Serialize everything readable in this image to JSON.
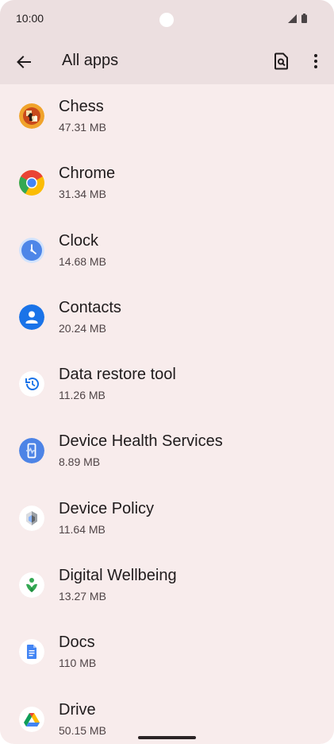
{
  "status_bar": {
    "time": "10:00",
    "icons": [
      "camera-cutout-icon",
      "cellular-signal-icon",
      "battery-icon"
    ]
  },
  "app_bar": {
    "back_icon": "arrow-back-icon",
    "title": "All apps",
    "search_icon": "search-icon",
    "more_icon": "more-vert-icon"
  },
  "apps": [
    {
      "name": "Chess",
      "size": "47.31 MB",
      "icon": "chess-icon"
    },
    {
      "name": "Chrome",
      "size": "31.34 MB",
      "icon": "chrome-icon"
    },
    {
      "name": "Clock",
      "size": "14.68 MB",
      "icon": "clock-icon"
    },
    {
      "name": "Contacts",
      "size": "20.24 MB",
      "icon": "contacts-icon"
    },
    {
      "name": "Data restore tool",
      "size": "11.26 MB",
      "icon": "data-restore-icon"
    },
    {
      "name": "Device Health Services",
      "size": "8.89 MB",
      "icon": "device-health-icon"
    },
    {
      "name": "Device Policy",
      "size": "11.64 MB",
      "icon": "device-policy-icon"
    },
    {
      "name": "Digital Wellbeing",
      "size": "13.27 MB",
      "icon": "digital-wellbeing-icon"
    },
    {
      "name": "Docs",
      "size": "110 MB",
      "icon": "docs-icon"
    },
    {
      "name": "Drive",
      "size": "50.15 MB",
      "icon": "drive-icon"
    }
  ],
  "colors": {
    "background": "#f8ecec",
    "app_bar": "#ecdfe0",
    "primary_text": "#1f1b1c",
    "secondary_text": "#4f4446"
  }
}
